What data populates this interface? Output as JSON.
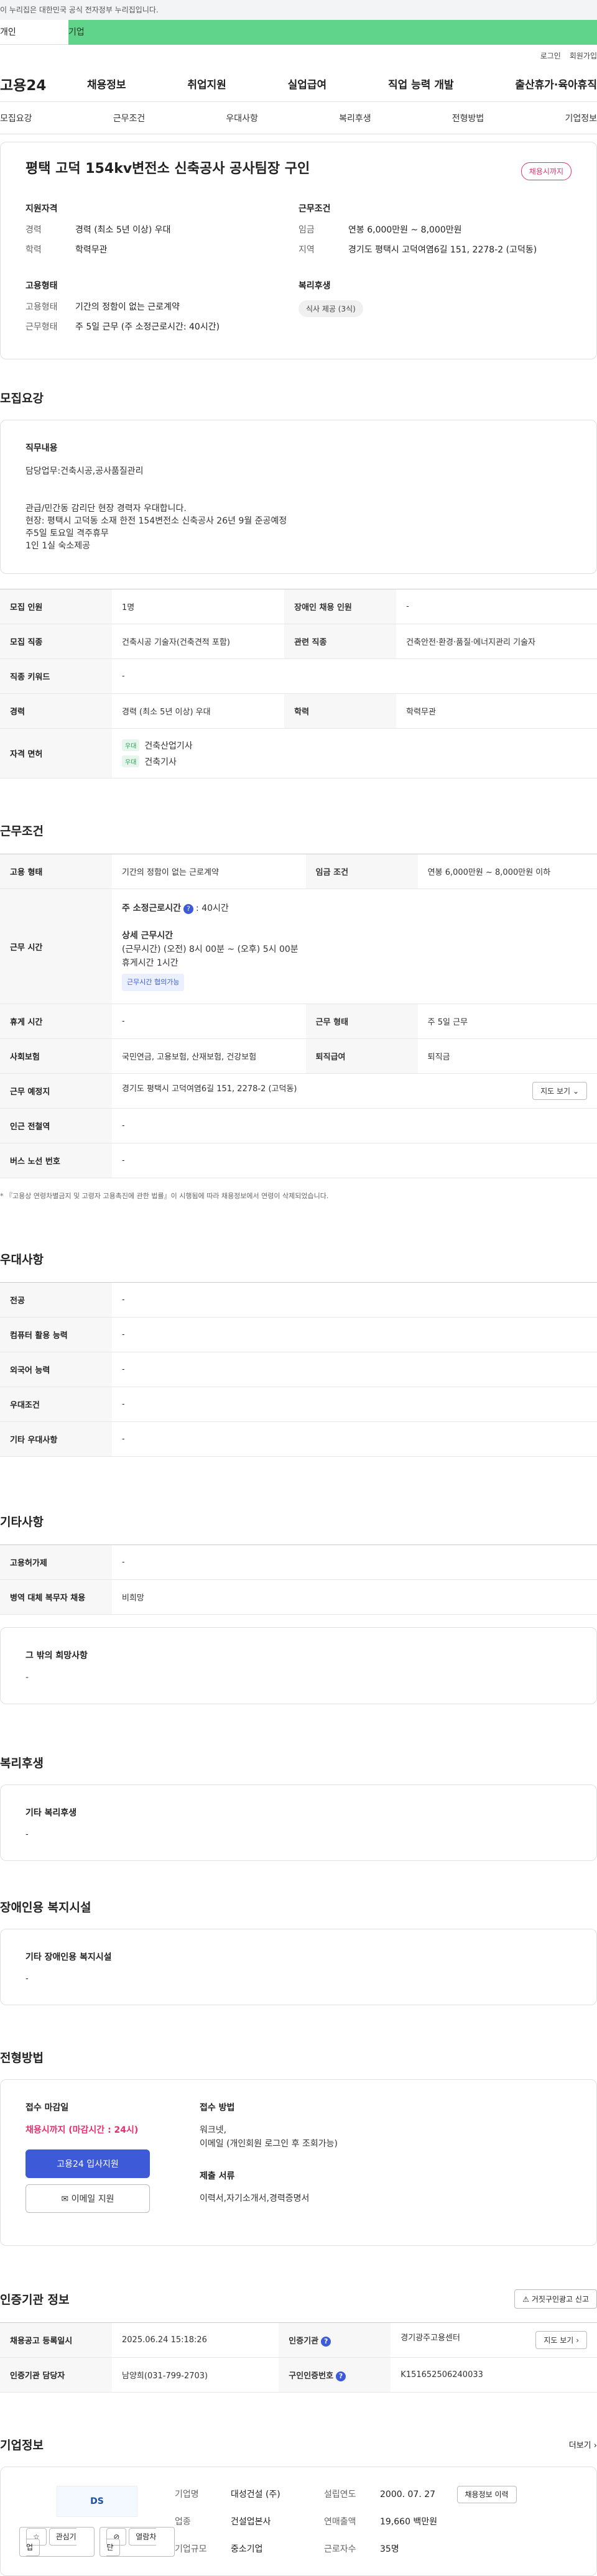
{
  "gov_banner": "이 누리집은 대한민국 공식 전자정부 누리집입니다.",
  "user_tabs": {
    "individual": "개인",
    "company": "기업"
  },
  "util": {
    "login": "로그인",
    "join": "회원가입"
  },
  "logo": "고용24",
  "gnb": [
    "채용정보",
    "취업지원",
    "실업급여",
    "직업 능력 개발",
    "출산휴가·육아휴직"
  ],
  "subnav": [
    "모집요강",
    "근무조건",
    "우대사항",
    "복리후생",
    "전형방법",
    "기업정보"
  ],
  "header": {
    "title": "평택 고덕 154kv변전소 신축공사 공사팀장 구인",
    "badge": "채용시까지",
    "qual_title": "지원자격",
    "career_k": "경력",
    "career_v": "경력 (최소 5년 이상) 우대",
    "edu_k": "학력",
    "edu_v": "학력무관",
    "cond_title": "근무조건",
    "wage_k": "임금",
    "wage_v": "연봉 6,000만원 ~ 8,000만원",
    "region_k": "지역",
    "region_v": "경기도 평택시 고덕여염6길 151, 2278-2 (고덕동)",
    "emp_title": "고용형태",
    "emptype_k": "고용형태",
    "emptype_v": "기간의 정함이 없는 근로계약",
    "worktype_k": "근무형태",
    "worktype_v": "주 5일 근무 (주 소정근로시간: 40시간)",
    "welfare_title": "복리후생",
    "welfare_chip": "식사 제공 (3식)"
  },
  "recruit": {
    "section": "모집요강",
    "duty_title": "직무내용",
    "duty_text": "담당업무:건축시공,공사품질관리\n\n\n관급/민간동  감리단 현장 경력자 우대합니다.\n현장: 평택시 고덕동 소재 한전 154변전소 신축공사   26년 9월 준공예정\n주5일 토요일 격주휴무\n1인 1실 숙소제공",
    "rows": {
      "count_k": "모집 인원",
      "count_v": "1명",
      "disabled_k": "장애인 채용 인원",
      "disabled_v": "-",
      "job_k": "모집 직종",
      "job_v": "건축시공 기술자(건축견적 포함)",
      "related_k": "관련 직종",
      "related_v": "건축안전·환경·품질·에너지관리 기술자",
      "keyword_k": "직종 키워드",
      "keyword_v": "-",
      "career_k": "경력",
      "career_v": "경력 (최소 5년 이상) 우대",
      "edu_k": "학력",
      "edu_v": "학력무관",
      "license_k": "자격 면허",
      "licenses": [
        {
          "tag": "우대",
          "name": "건축산업기사"
        },
        {
          "tag": "우대",
          "name": "건축기사"
        }
      ]
    }
  },
  "work": {
    "section": "근무조건",
    "emptype_k": "고용 형태",
    "emptype_v": "기간의 정함이 없는 근로계약",
    "wage_k": "임금 조건",
    "wage_v": "연봉 6,000만원 ~ 8,000만원 이하",
    "hours_k": "근무 시간",
    "hours_weekly": "주 소정근로시간",
    "hours_weekly_val": ": 40시간",
    "hours_detail_title": "상세 근무시간",
    "hours_detail_1": "(근무시간) (오전) 8시 00분 ~ (오후) 5시 00분",
    "hours_detail_2": "휴게시간 1시간",
    "hours_chip": "근무시간 협의가능",
    "rest_k": "휴게 시간",
    "rest_v": "-",
    "form_k": "근무 형태",
    "form_v": "주 5일 근무",
    "insurance_k": "사회보험",
    "insurance_v": "국민연금, 고용보험, 산재보험, 건강보험",
    "severance_k": "퇴직급여",
    "severance_v": "퇴직금",
    "place_k": "근무 예정지",
    "place_v": "경기도 평택시 고덕여염6길 151, 2278-2 (고덕동)",
    "map_btn": "지도 보기",
    "subway_k": "인근 전철역",
    "subway_v": "-",
    "bus_k": "버스 노선 번호",
    "bus_v": "-",
    "notice": "* 『고용상 연령차별금지 및 고령자 고용촉진에 관한 법률』이 시행됨에 따라 채용정보에서 연령이 삭제되었습니다."
  },
  "pref": {
    "section": "우대사항",
    "major_k": "전공",
    "major_v": "-",
    "computer_k": "컴퓨터 활용 능력",
    "computer_v": "-",
    "lang_k": "외국어 능력",
    "lang_v": "-",
    "cond_k": "우대조건",
    "cond_v": "-",
    "etc_k": "기타 우대사항",
    "etc_v": "-"
  },
  "other": {
    "section": "기타사항",
    "permit_k": "고용허가제",
    "permit_v": "-",
    "military_k": "병역 대체 복무자 채용",
    "military_v": "비희망",
    "extra_title": "그 밖의 희망사항",
    "extra_v": "-"
  },
  "welfare": {
    "section": "복리후생",
    "title": "기타 복리후생",
    "v": "-"
  },
  "disabled": {
    "section": "장애인용 복지시설",
    "title": "기타 장애인용 복지시설",
    "v": "-"
  },
  "method": {
    "section": "전형방법",
    "deadline_title": "접수 마감일",
    "deadline_v": "채용시까지 (마감시간 : 24시)",
    "apply_btn": "고용24 입사지원",
    "email_btn": "이메일 지원",
    "how_title": "접수 방법",
    "how_v": "워크넷,\n이메일 (개인회원 로그인 후 조회가능)",
    "docs_title": "제출 서류",
    "docs_v": "이력서,자기소개서,경력증명서"
  },
  "agency": {
    "section": "인증기관 정보",
    "report_btn": "거짓구인광고 신고",
    "reg_k": "채용공고 등록일시",
    "reg_v": "2025.06.24 15:18:26",
    "agency_k": "인증기관",
    "agency_v": "경기광주고용센터",
    "map_btn": "지도 보기",
    "manager_k": "인증기관 담당자",
    "manager_v": "남양희(031-799-2703)",
    "num_k": "구인인증번호",
    "num_v": "K151652506240033"
  },
  "company": {
    "section": "기업정보",
    "more": "더보기",
    "logo_text": "DS",
    "interest_btn": "관심기업",
    "block_btn": "열람차단",
    "name_k": "기업명",
    "name_v": "대성건설 (주)",
    "founded_k": "설립연도",
    "founded_v": "2000. 07. 27",
    "list_btn": "채용정보 이력",
    "biz_k": "업종",
    "biz_v": "건설업본사",
    "sales_k": "연매출액",
    "sales_v": "19,660 백만원",
    "size_k": "기업규모",
    "size_v": "중소기업",
    "staff_k": "근로자수",
    "staff_v": "35명"
  }
}
